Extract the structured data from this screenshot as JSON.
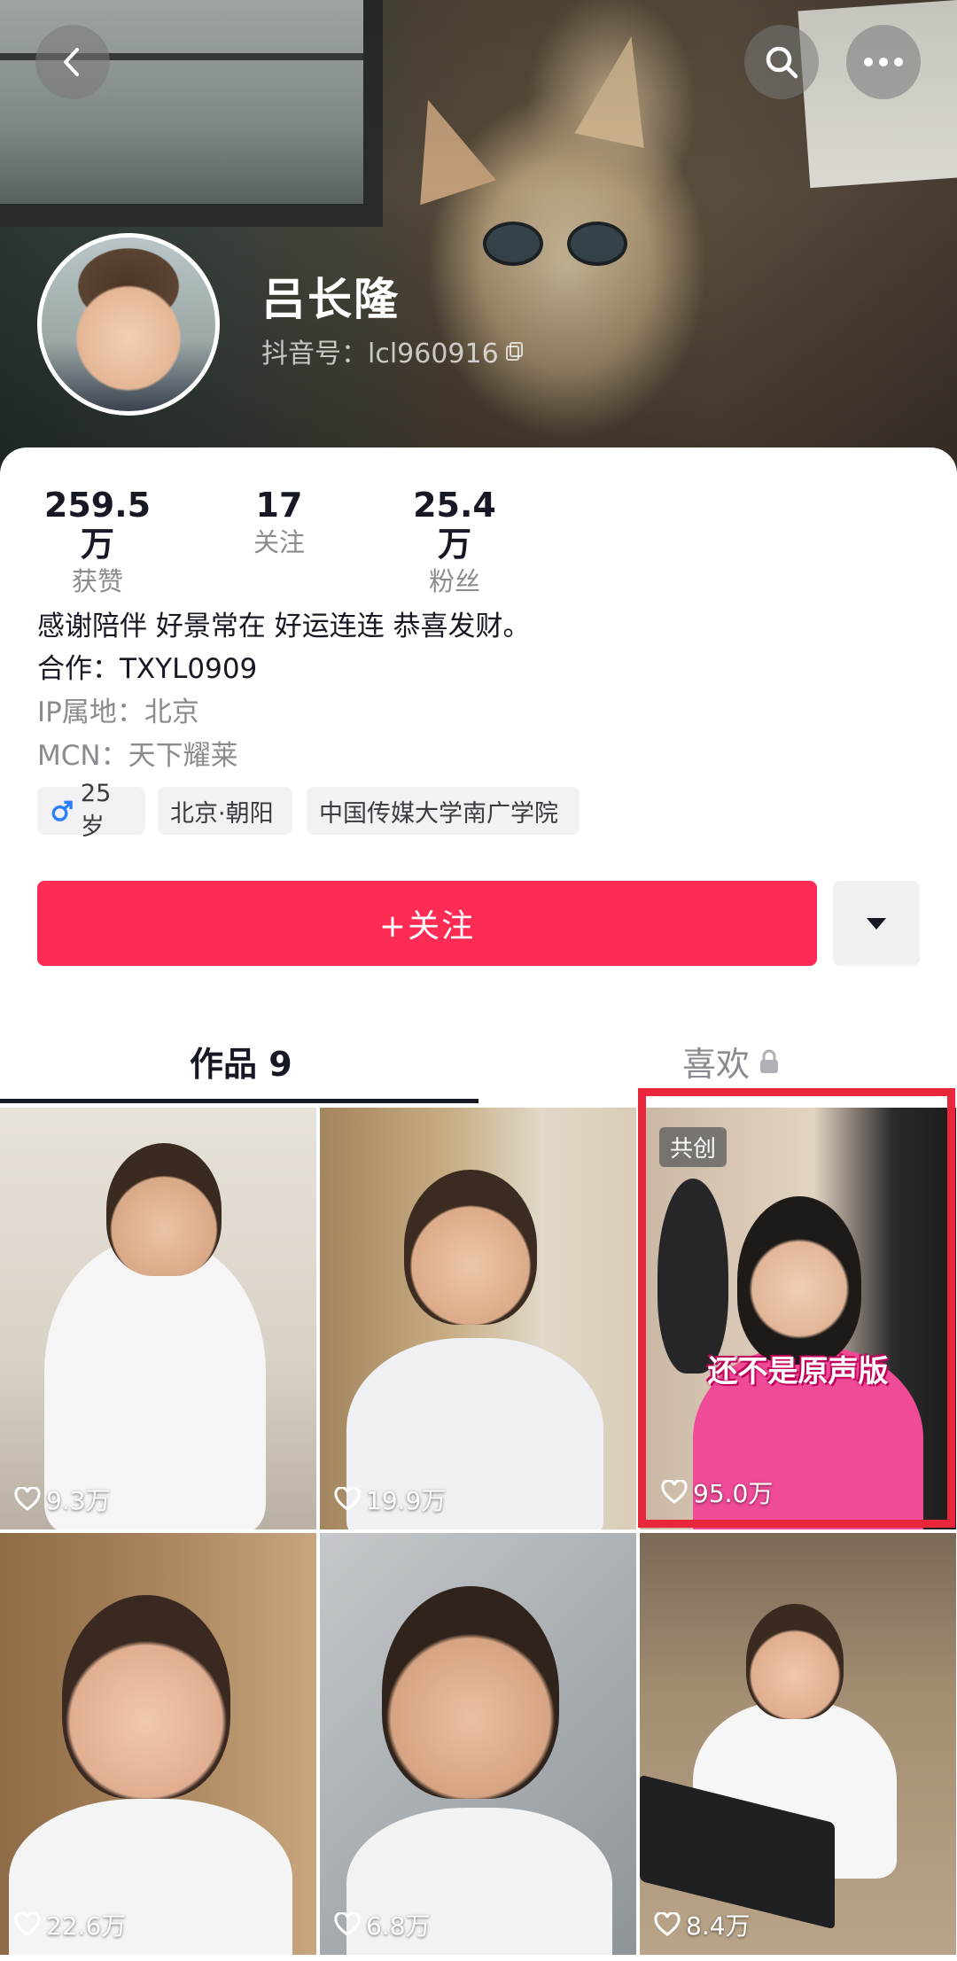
{
  "header": {
    "name": "吕长隆",
    "douyin_id": "抖音号：lcl960916",
    "back_icon": "chevron-left-icon",
    "search_icon": "search-icon",
    "more_icon": "more-horizontal-icon"
  },
  "stats": [
    {
      "value": "259.5万",
      "label": "获赞"
    },
    {
      "value": "17",
      "label": "关注"
    },
    {
      "value": "25.4万",
      "label": "粉丝"
    }
  ],
  "bio": {
    "signature": "感谢陪伴 好景常在 好运连连 恭喜发财。",
    "cooperation": "合作：TXYL0909",
    "ip_location": "IP属地：北京",
    "mcn": "MCN：天下耀莱"
  },
  "tags": {
    "gender_age": "25岁",
    "location": "北京·朝阳",
    "school": "中国传媒大学南广学院"
  },
  "actions": {
    "follow_label": "+关注",
    "dropdown_icon": "caret-down-icon"
  },
  "tabs": [
    {
      "label": "作品 9",
      "active": true
    },
    {
      "label": "喜欢",
      "locked": true,
      "active": false
    }
  ],
  "videos": [
    {
      "likes": "9.3万"
    },
    {
      "likes": "19.9万"
    },
    {
      "likes": "95.0万",
      "badge": "共创",
      "caption": "还不是原声版",
      "highlighted": true
    },
    {
      "likes": "22.6万"
    },
    {
      "likes": "6.8万"
    },
    {
      "likes": "8.4万"
    }
  ],
  "colors": {
    "accent": "#fe2c55",
    "highlight_border": "#e8273d",
    "male_symbol": "#2b7fff"
  }
}
